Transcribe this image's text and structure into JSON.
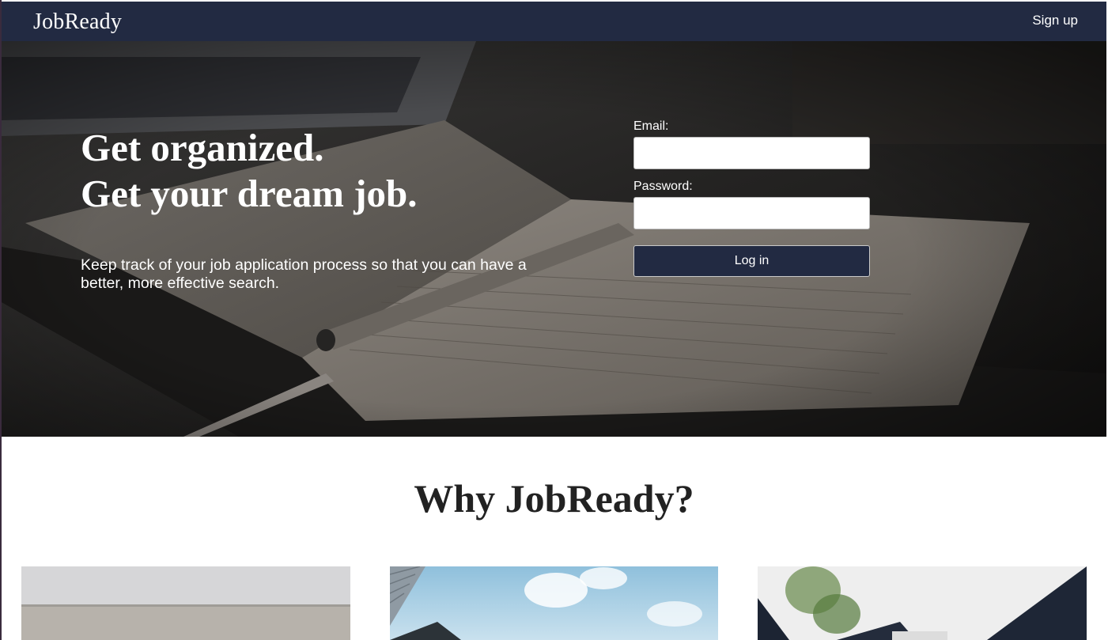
{
  "navbar": {
    "brand": "JobReady",
    "signup_label": "Sign up"
  },
  "hero": {
    "headline_line1": "Get organized.",
    "headline_line2": "Get your dream job.",
    "subtitle": "Keep track of your job application process so that you can have a better, more effective search."
  },
  "login": {
    "email_label": "Email:",
    "email_value": "",
    "password_label": "Password:",
    "password_value": "",
    "submit_label": "Log in"
  },
  "why": {
    "title": "Why JobReady?"
  },
  "colors": {
    "nav_background": "#222a42",
    "button_background": "#222a42",
    "text_on_dark": "#ffffff",
    "heading_dark": "#222222"
  }
}
